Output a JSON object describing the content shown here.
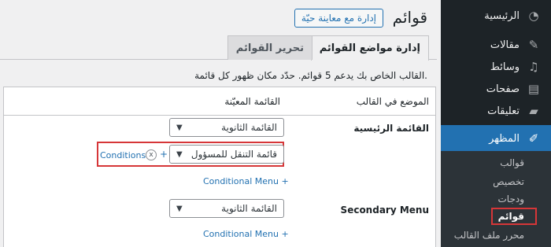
{
  "sidebar": {
    "items": [
      {
        "label": "الرئيسية",
        "icon": "dashboard-icon"
      },
      {
        "label": "مقالات",
        "icon": "pin-icon"
      },
      {
        "label": "وسائط",
        "icon": "media-icon"
      },
      {
        "label": "صفحات",
        "icon": "pages-icon"
      },
      {
        "label": "تعليقات",
        "icon": "comments-icon"
      },
      {
        "label": "المظهر",
        "icon": "appearance-icon"
      }
    ],
    "submenu": [
      "قوالب",
      "تخصيص",
      "ودجات",
      "قوائم",
      "محرر ملف القالب"
    ]
  },
  "header": {
    "title": "قوائم",
    "live_preview_label": "إدارة مع معاينة حيّة"
  },
  "tabs": {
    "edit_menus": "تحرير القوائم",
    "manage_locations": "إدارة مواضع القوائم"
  },
  "description": "القالب الخاص بك يدعم 5 قوائم. حدّد مكان ظهور كل قائمة.",
  "table": {
    "col_location": "الموضع في القالب",
    "col_assigned": "القائمة المعيّنة",
    "rows": [
      {
        "location": "القائمة الرئيسية",
        "selected": "القائمة الثانوية",
        "conditional_selected": "قائمة التنقل للمسؤول",
        "conditions_label": "Conditions",
        "plus": "+",
        "remove": "x",
        "conditional_menu_label": "Conditional Menu +"
      },
      {
        "location": "Secondary Menu",
        "selected": "القائمة الثانوية",
        "conditional_menu_label": "Conditional Menu +"
      }
    ]
  },
  "colors": {
    "admin_bar": "#1d2327",
    "accent": "#2271b1",
    "highlight": "#d63638"
  }
}
